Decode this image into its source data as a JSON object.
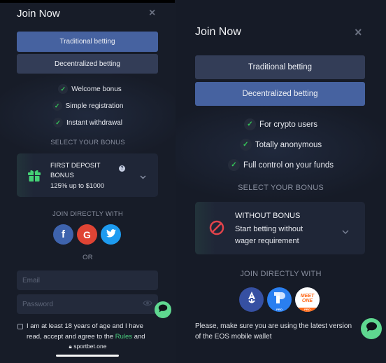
{
  "left": {
    "title": "Join Now",
    "close_icon": "×",
    "tabs": [
      {
        "label": "Traditional betting",
        "active": true
      },
      {
        "label": "Decentralized betting",
        "active": false
      }
    ],
    "features": [
      "Welcome bonus",
      "Simple registration",
      "Instant withdrawal"
    ],
    "select_bonus_label": "SELECT YOUR BONUS",
    "bonus": {
      "icon": "gift-icon",
      "title_line1": "FIRST DEPOSIT",
      "title_line2": "BONUS",
      "subtitle": "125% up to $1000",
      "help_icon": "?"
    },
    "join_directly_label": "JOIN DIRECTLY WITH",
    "social": [
      {
        "name": "facebook",
        "glyph": "f",
        "color": "#3e63ad"
      },
      {
        "name": "google",
        "glyph": "G",
        "color": "#e04434"
      },
      {
        "name": "twitter",
        "glyph": "twitter-bird",
        "color": "#1d9bf0"
      }
    ],
    "or_label": "OR",
    "email_placeholder": "Email",
    "password_placeholder": "Password",
    "terms_line1": "I am at least 18 years of age and I have",
    "terms_line2_pre": "read, accept and agree to the ",
    "terms_rules_link": "Rules",
    "terms_line2_post": " and",
    "url": "sportbet.one"
  },
  "right": {
    "title": "Join Now",
    "close_icon": "×",
    "tabs": [
      {
        "label": "Traditional betting",
        "active": false
      },
      {
        "label": "Decentralized betting",
        "active": true
      }
    ],
    "features": [
      "For crypto users",
      "Totally anonymous",
      "Full control on your funds"
    ],
    "select_bonus_label": "SELECT YOUR BONUS",
    "bonus": {
      "icon": "no-entry-icon",
      "title": "WITHOUT BONUS",
      "subtitle_line1": "Start betting without",
      "subtitle_line2": "wager requirement"
    },
    "join_directly_label": "JOIN DIRECTLY WITH",
    "wallets": [
      {
        "name": "anchor",
        "color": "#3650a2"
      },
      {
        "name": "tokenpocket",
        "color": "#2a7ff0",
        "badge": "PRO"
      },
      {
        "name": "meetone",
        "text_line1": "MEET",
        "text_line2": "ONE",
        "badge": "PRO",
        "color": "#ff6a1a"
      }
    ],
    "note_line1": "Please, make sure you are using the latest version",
    "note_line2": "of the EOS mobile wallet"
  },
  "colors": {
    "accent_active_tab": "#4662a0",
    "inactive_tab": "#333d57",
    "check_green": "#35c759",
    "chat_green": "#5fd890",
    "link_green": "#4bd07f"
  }
}
